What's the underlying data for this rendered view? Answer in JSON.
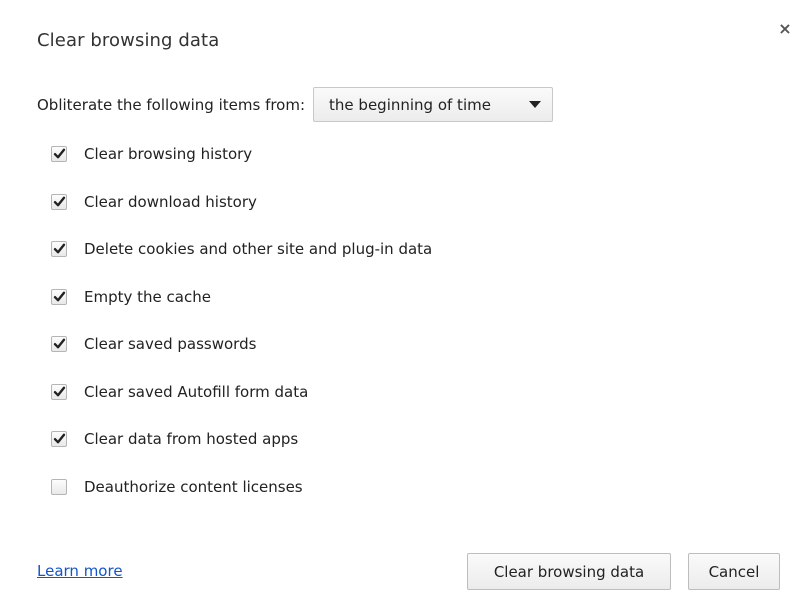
{
  "dialog": {
    "title": "Clear browsing data",
    "close_glyph": "×"
  },
  "range": {
    "label": "Obliterate the following items from:",
    "selected": "the beginning of time"
  },
  "options": [
    {
      "label": "Clear browsing history",
      "checked": true
    },
    {
      "label": "Clear download history",
      "checked": true
    },
    {
      "label": "Delete cookies and other site and plug-in data",
      "checked": true
    },
    {
      "label": "Empty the cache",
      "checked": true
    },
    {
      "label": "Clear saved passwords",
      "checked": true
    },
    {
      "label": "Clear saved Autofill form data",
      "checked": true
    },
    {
      "label": "Clear data from hosted apps",
      "checked": true
    },
    {
      "label": "Deauthorize content licenses",
      "checked": false
    }
  ],
  "footer": {
    "learn_more": "Learn more",
    "clear_button": "Clear browsing data",
    "cancel_button": "Cancel"
  },
  "icons": {
    "close": "close-icon",
    "dropdown": "chevron-down-icon",
    "check": "checkmark-icon"
  },
  "colors": {
    "link": "#1155cc",
    "text": "#222222"
  }
}
